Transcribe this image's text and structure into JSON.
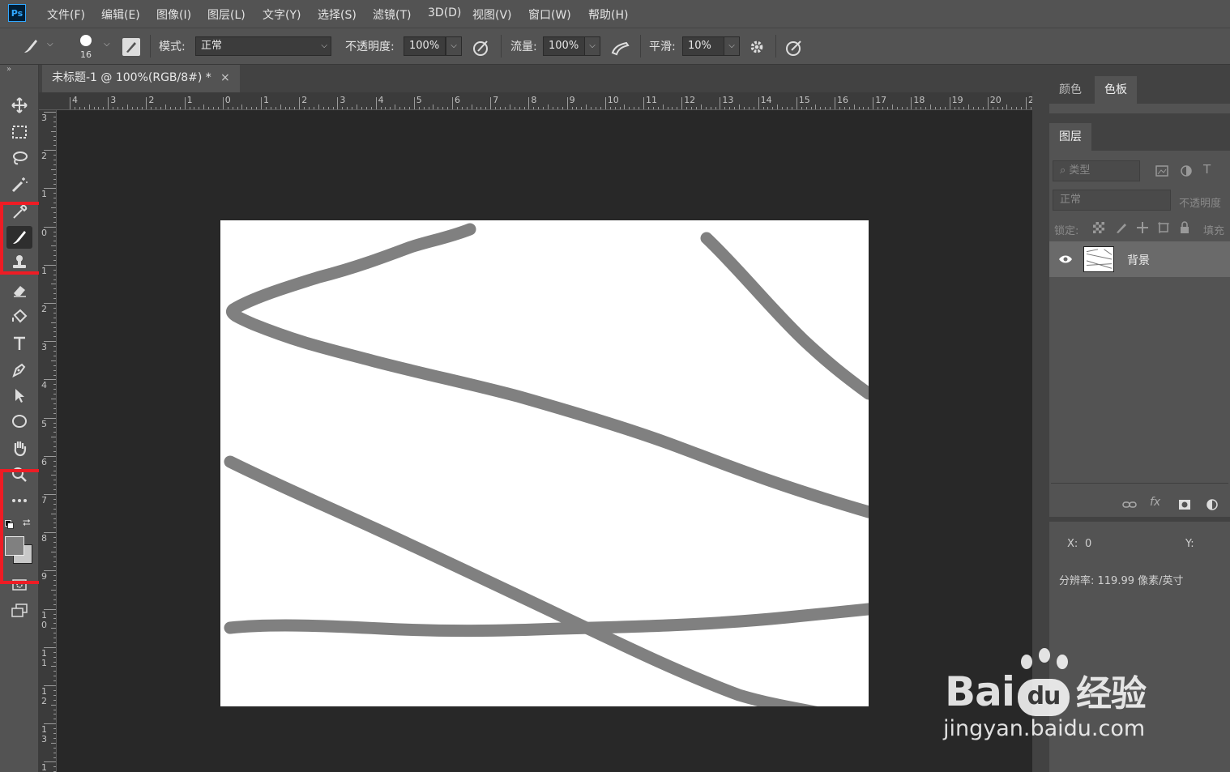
{
  "app": {
    "logo": "Ps"
  },
  "menu": [
    "文件(F)",
    "编辑(E)",
    "图像(I)",
    "图层(L)",
    "文字(Y)",
    "选择(S)",
    "滤镜(T)",
    "3D(D)",
    "视图(V)",
    "窗口(W)",
    "帮助(H)"
  ],
  "options": {
    "brush_size": "16",
    "mode_label": "模式:",
    "mode_value": "正常",
    "opacity_label": "不透明度:",
    "opacity_value": "100%",
    "flow_label": "流量:",
    "flow_value": "100%",
    "smoothing_label": "平滑:",
    "smoothing_value": "10%"
  },
  "document": {
    "tab_title": "未标题-1 @ 100%(RGB/8#) *",
    "close": "×"
  },
  "ruler_top_labels": [
    "4",
    "3",
    "2",
    "1",
    "0",
    "1",
    "2",
    "3",
    "4",
    "5",
    "6",
    "7",
    "8",
    "9",
    "10",
    "11",
    "12",
    "13",
    "14",
    "15",
    "16",
    "17",
    "18",
    "19",
    "20",
    "2"
  ],
  "ruler_left_labels": [
    "3",
    "2",
    "1",
    "0",
    "1",
    "2",
    "3",
    "4",
    "5",
    "6",
    "7",
    "8",
    "9",
    "1 0",
    "1 1",
    "1 2",
    "1 3",
    "1"
  ],
  "panels": {
    "top_tabs": [
      "颜色",
      "色板"
    ],
    "layers_tab": "图层",
    "filter_placeholder": "类型",
    "blend_mode": "正常",
    "opacity_label": "不透明度",
    "lock_label": "锁定:",
    "fill_label": "填充",
    "layer_name": "背景"
  },
  "info": {
    "x_label": "X:",
    "x_value": "0",
    "y_label": "Y:",
    "resolution": "分辨率: 119.99 像素/英寸"
  },
  "watermark": {
    "brand": "Bai",
    "brand2": "du",
    "cn": "经验",
    "url": "jingyan.baidu.com"
  },
  "colors": {
    "highlight": "#ee1c24",
    "stroke": "#808080",
    "canvas": "#ffffff",
    "workspace": "#282828"
  }
}
